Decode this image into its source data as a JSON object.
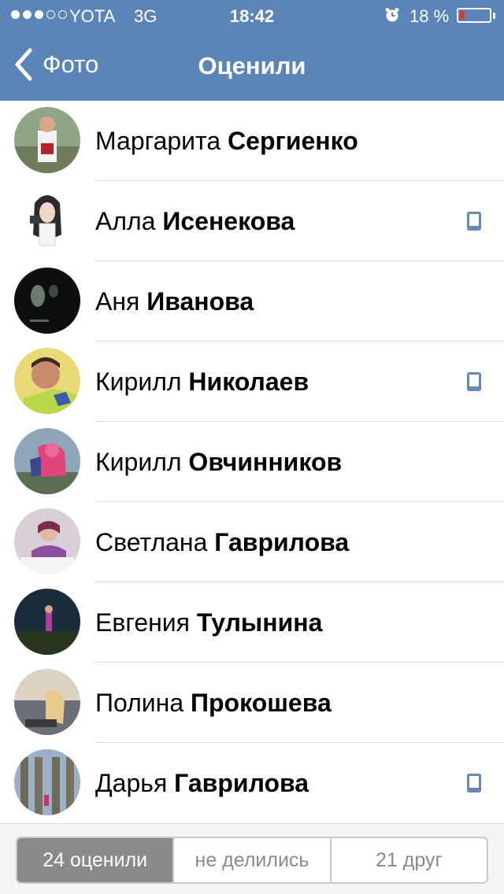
{
  "status_bar": {
    "carrier": "YOTA",
    "network": "3G",
    "time": "18:42",
    "battery_percent": "18 %",
    "battery_level": 0.18,
    "signal_dots_filled": 3,
    "signal_dots_total": 5
  },
  "nav": {
    "back_label": "Фото",
    "title": "Оценили"
  },
  "colors": {
    "nav_background": "#5b84b8",
    "phone_icon": "#6488b8",
    "battery_low": "#e23b32"
  },
  "people": [
    {
      "first": "Маргарита",
      "last": "Сергиенко",
      "mobile": false
    },
    {
      "first": "Алла",
      "last": "Исенекова",
      "mobile": true
    },
    {
      "first": "Аня",
      "last": "Иванова",
      "mobile": false
    },
    {
      "first": "Кирилл",
      "last": "Николаев",
      "mobile": true
    },
    {
      "first": "Кирилл",
      "last": "Овчинников",
      "mobile": false
    },
    {
      "first": "Светлана",
      "last": "Гаврилова",
      "mobile": false
    },
    {
      "first": "Евгения",
      "last": "Тулынина",
      "mobile": false
    },
    {
      "first": "Полина",
      "last": "Прокошева",
      "mobile": false
    },
    {
      "first": "Дарья",
      "last": "Гаврилова",
      "mobile": true
    }
  ],
  "tabs": {
    "rated": "24 оценили",
    "not_shared": "не делились",
    "friends": "21 друг",
    "selected": "rated"
  }
}
